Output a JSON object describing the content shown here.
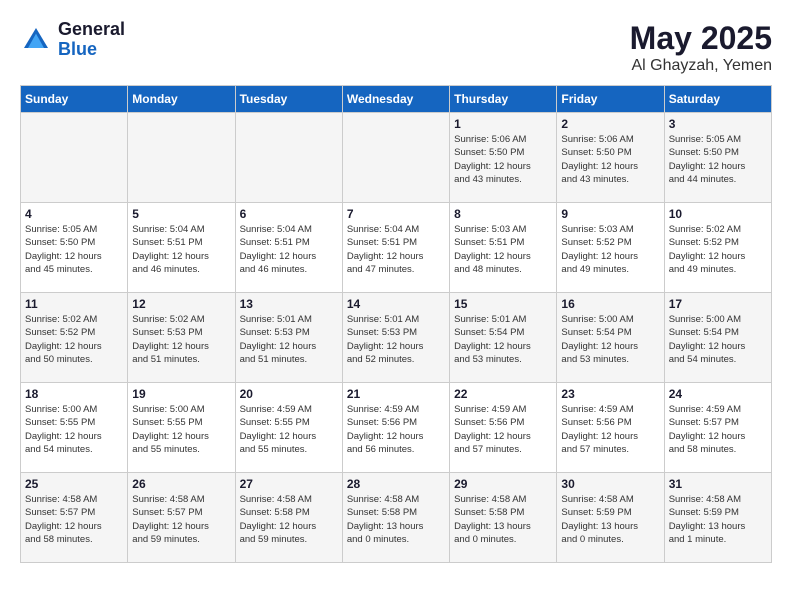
{
  "header": {
    "logo_general": "General",
    "logo_blue": "Blue",
    "month_year": "May 2025",
    "location": "Al Ghayzah, Yemen"
  },
  "days_of_week": [
    "Sunday",
    "Monday",
    "Tuesday",
    "Wednesday",
    "Thursday",
    "Friday",
    "Saturday"
  ],
  "weeks": [
    {
      "cells": [
        {
          "day": "",
          "info": ""
        },
        {
          "day": "",
          "info": ""
        },
        {
          "day": "",
          "info": ""
        },
        {
          "day": "",
          "info": ""
        },
        {
          "day": "1",
          "info": "Sunrise: 5:06 AM\nSunset: 5:50 PM\nDaylight: 12 hours\nand 43 minutes."
        },
        {
          "day": "2",
          "info": "Sunrise: 5:06 AM\nSunset: 5:50 PM\nDaylight: 12 hours\nand 43 minutes."
        },
        {
          "day": "3",
          "info": "Sunrise: 5:05 AM\nSunset: 5:50 PM\nDaylight: 12 hours\nand 44 minutes."
        }
      ]
    },
    {
      "cells": [
        {
          "day": "4",
          "info": "Sunrise: 5:05 AM\nSunset: 5:50 PM\nDaylight: 12 hours\nand 45 minutes."
        },
        {
          "day": "5",
          "info": "Sunrise: 5:04 AM\nSunset: 5:51 PM\nDaylight: 12 hours\nand 46 minutes."
        },
        {
          "day": "6",
          "info": "Sunrise: 5:04 AM\nSunset: 5:51 PM\nDaylight: 12 hours\nand 46 minutes."
        },
        {
          "day": "7",
          "info": "Sunrise: 5:04 AM\nSunset: 5:51 PM\nDaylight: 12 hours\nand 47 minutes."
        },
        {
          "day": "8",
          "info": "Sunrise: 5:03 AM\nSunset: 5:51 PM\nDaylight: 12 hours\nand 48 minutes."
        },
        {
          "day": "9",
          "info": "Sunrise: 5:03 AM\nSunset: 5:52 PM\nDaylight: 12 hours\nand 49 minutes."
        },
        {
          "day": "10",
          "info": "Sunrise: 5:02 AM\nSunset: 5:52 PM\nDaylight: 12 hours\nand 49 minutes."
        }
      ]
    },
    {
      "cells": [
        {
          "day": "11",
          "info": "Sunrise: 5:02 AM\nSunset: 5:52 PM\nDaylight: 12 hours\nand 50 minutes."
        },
        {
          "day": "12",
          "info": "Sunrise: 5:02 AM\nSunset: 5:53 PM\nDaylight: 12 hours\nand 51 minutes."
        },
        {
          "day": "13",
          "info": "Sunrise: 5:01 AM\nSunset: 5:53 PM\nDaylight: 12 hours\nand 51 minutes."
        },
        {
          "day": "14",
          "info": "Sunrise: 5:01 AM\nSunset: 5:53 PM\nDaylight: 12 hours\nand 52 minutes."
        },
        {
          "day": "15",
          "info": "Sunrise: 5:01 AM\nSunset: 5:54 PM\nDaylight: 12 hours\nand 53 minutes."
        },
        {
          "day": "16",
          "info": "Sunrise: 5:00 AM\nSunset: 5:54 PM\nDaylight: 12 hours\nand 53 minutes."
        },
        {
          "day": "17",
          "info": "Sunrise: 5:00 AM\nSunset: 5:54 PM\nDaylight: 12 hours\nand 54 minutes."
        }
      ]
    },
    {
      "cells": [
        {
          "day": "18",
          "info": "Sunrise: 5:00 AM\nSunset: 5:55 PM\nDaylight: 12 hours\nand 54 minutes."
        },
        {
          "day": "19",
          "info": "Sunrise: 5:00 AM\nSunset: 5:55 PM\nDaylight: 12 hours\nand 55 minutes."
        },
        {
          "day": "20",
          "info": "Sunrise: 4:59 AM\nSunset: 5:55 PM\nDaylight: 12 hours\nand 55 minutes."
        },
        {
          "day": "21",
          "info": "Sunrise: 4:59 AM\nSunset: 5:56 PM\nDaylight: 12 hours\nand 56 minutes."
        },
        {
          "day": "22",
          "info": "Sunrise: 4:59 AM\nSunset: 5:56 PM\nDaylight: 12 hours\nand 57 minutes."
        },
        {
          "day": "23",
          "info": "Sunrise: 4:59 AM\nSunset: 5:56 PM\nDaylight: 12 hours\nand 57 minutes."
        },
        {
          "day": "24",
          "info": "Sunrise: 4:59 AM\nSunset: 5:57 PM\nDaylight: 12 hours\nand 58 minutes."
        }
      ]
    },
    {
      "cells": [
        {
          "day": "25",
          "info": "Sunrise: 4:58 AM\nSunset: 5:57 PM\nDaylight: 12 hours\nand 58 minutes."
        },
        {
          "day": "26",
          "info": "Sunrise: 4:58 AM\nSunset: 5:57 PM\nDaylight: 12 hours\nand 59 minutes."
        },
        {
          "day": "27",
          "info": "Sunrise: 4:58 AM\nSunset: 5:58 PM\nDaylight: 12 hours\nand 59 minutes."
        },
        {
          "day": "28",
          "info": "Sunrise: 4:58 AM\nSunset: 5:58 PM\nDaylight: 13 hours\nand 0 minutes."
        },
        {
          "day": "29",
          "info": "Sunrise: 4:58 AM\nSunset: 5:58 PM\nDaylight: 13 hours\nand 0 minutes."
        },
        {
          "day": "30",
          "info": "Sunrise: 4:58 AM\nSunset: 5:59 PM\nDaylight: 13 hours\nand 0 minutes."
        },
        {
          "day": "31",
          "info": "Sunrise: 4:58 AM\nSunset: 5:59 PM\nDaylight: 13 hours\nand 1 minute."
        }
      ]
    }
  ]
}
